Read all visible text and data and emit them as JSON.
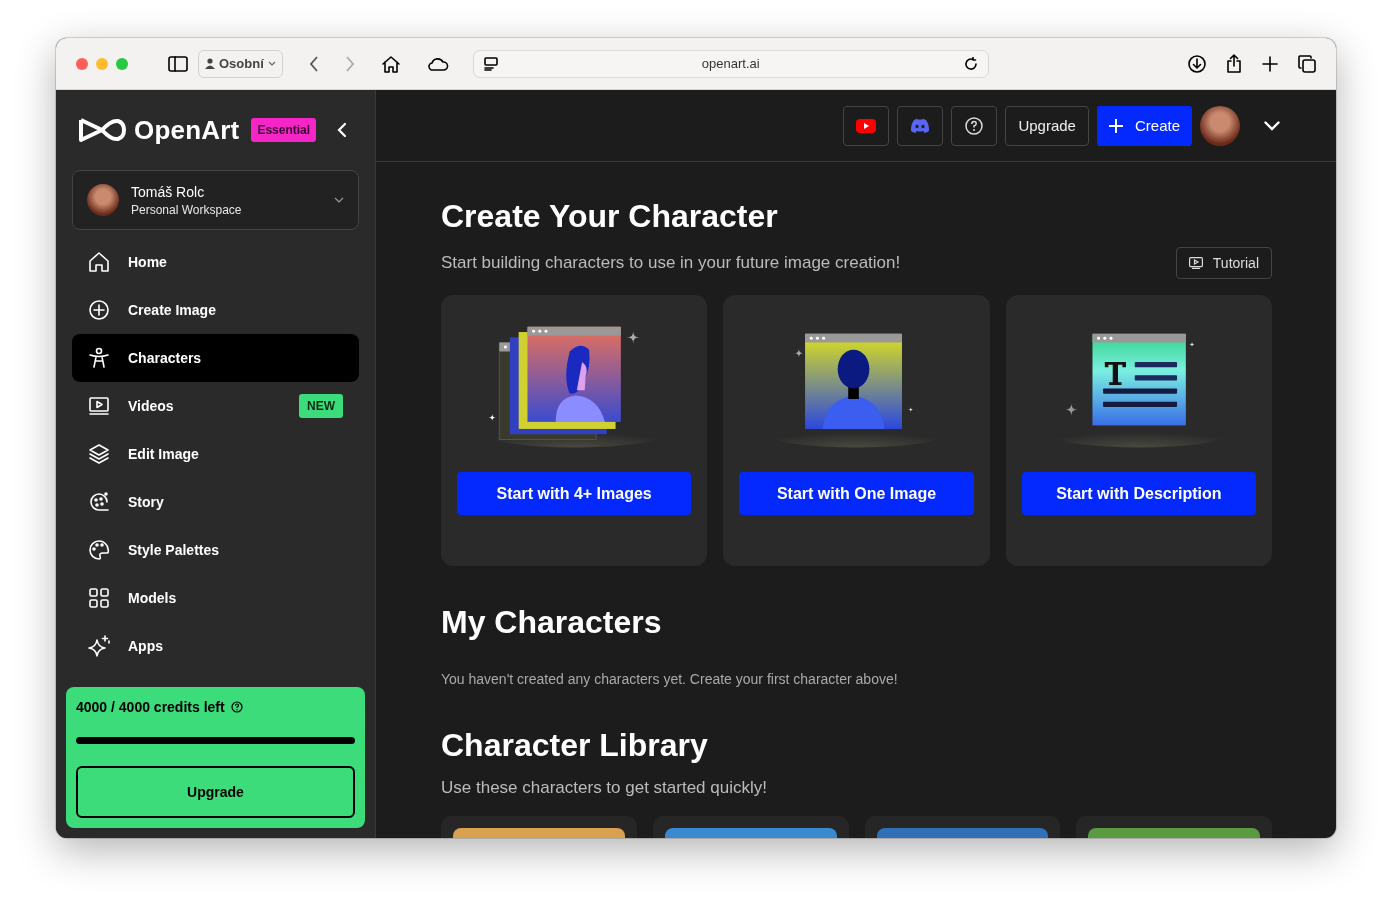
{
  "browser": {
    "profile": "Osobní",
    "address": "openart.ai"
  },
  "sidebar": {
    "logo": "OpenArt",
    "plan_badge": "Essential",
    "workspace": {
      "name": "Tomáš Rolc",
      "subtitle": "Personal Workspace"
    },
    "items": [
      {
        "label": "Home",
        "selected": false
      },
      {
        "label": "Create Image",
        "selected": false
      },
      {
        "label": "Characters",
        "selected": true
      },
      {
        "label": "Videos",
        "selected": false,
        "badge": "NEW"
      },
      {
        "label": "Edit Image",
        "selected": false
      },
      {
        "label": "Story",
        "selected": false
      },
      {
        "label": "Style Palettes",
        "selected": false
      },
      {
        "label": "Models",
        "selected": false
      },
      {
        "label": "Apps",
        "selected": false
      }
    ],
    "credits": {
      "text": "4000 / 4000 credits left",
      "level": 1.0,
      "button": "Upgrade"
    }
  },
  "topbar": {
    "upgrade": "Upgrade",
    "create": "Create"
  },
  "create_section": {
    "title": "Create Your Character",
    "subtitle": "Start building characters to use in your future image creation!",
    "tutorial": "Tutorial",
    "options": [
      {
        "kind": "multi",
        "button": "Start with 4+ Images"
      },
      {
        "kind": "single",
        "button": "Start with One Image"
      },
      {
        "kind": "text",
        "button": "Start with Description"
      }
    ]
  },
  "my_characters": {
    "title": "My Characters",
    "empty": "You haven't created any characters yet. Create your first character above!"
  },
  "library": {
    "title": "Character Library",
    "subtitle": "Use these characters to get started quickly!",
    "cards": [
      {
        "kind": "photo"
      },
      {
        "kind": "photo"
      },
      {
        "kind": "photo"
      },
      {
        "kind": "photo"
      }
    ]
  }
}
